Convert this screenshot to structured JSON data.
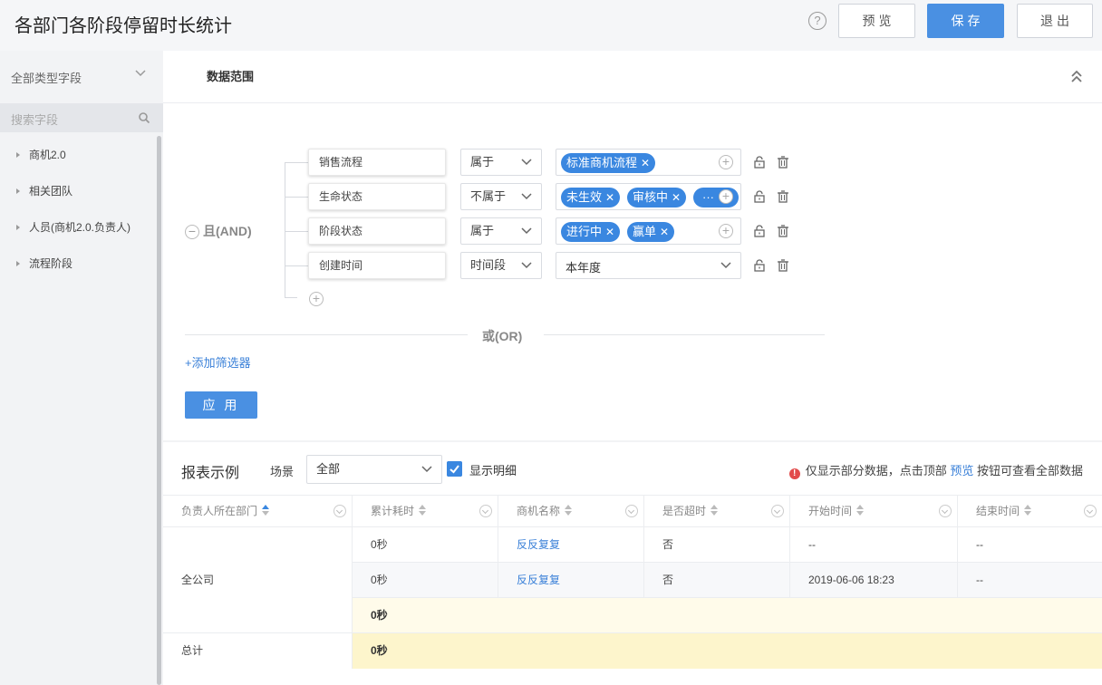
{
  "header": {
    "title": "各部门各阶段停留时长统计",
    "help_icon": "?",
    "preview_label": "预览",
    "save_label": "保存",
    "exit_label": "退出"
  },
  "sidebar": {
    "field_type": "全部类型字段",
    "search_placeholder": "搜索字段",
    "items": [
      {
        "label": "商机2.0"
      },
      {
        "label": "相关团队"
      },
      {
        "label": "人员(商机2.0.负责人)"
      },
      {
        "label": "流程阶段"
      }
    ]
  },
  "filter": {
    "section_title": "数据范围",
    "and_label": "且(AND)",
    "or_label": "或(OR)",
    "add_filter": "+添加筛选器",
    "apply_label": "应 用",
    "rows": [
      {
        "field": "销售流程",
        "operator": "属于",
        "tags": [
          "标准商机流程"
        ]
      },
      {
        "field": "生命状态",
        "operator": "不属于",
        "tags": [
          "未生效",
          "审核中"
        ],
        "more": "···"
      },
      {
        "field": "阶段状态",
        "operator": "属于",
        "tags": [
          "进行中",
          "赢单"
        ]
      },
      {
        "field": "创建时间",
        "operator": "时间段",
        "value": "本年度"
      }
    ]
  },
  "report": {
    "title": "报表示例",
    "scene_label": "场景",
    "scene_value": "全部",
    "show_detail_label": "显示明细",
    "show_detail_checked": true,
    "notice": {
      "before": "仅显示部分数据，点击顶部",
      "link": "预览",
      "after": "按钮可查看全部数据"
    },
    "columns": [
      "负责人所在部门",
      "累计耗时",
      "商机名称",
      "是否超时",
      "开始时间",
      "结束时间"
    ],
    "group": "全公司",
    "rows": [
      [
        "0秒",
        "反反复复",
        "否",
        "--",
        "--"
      ],
      [
        "0秒",
        "反反复复",
        "否",
        "2019-06-06 18:23",
        "--"
      ]
    ],
    "subtotal": "0秒",
    "total_label": "总计",
    "total_value": "0秒"
  },
  "colors": {
    "primary": "#4a90e2",
    "tag": "#3a87e0",
    "link": "#3a80d8",
    "subtotal_bg": "#fffbea",
    "total_bg": "#fdf5cc"
  }
}
